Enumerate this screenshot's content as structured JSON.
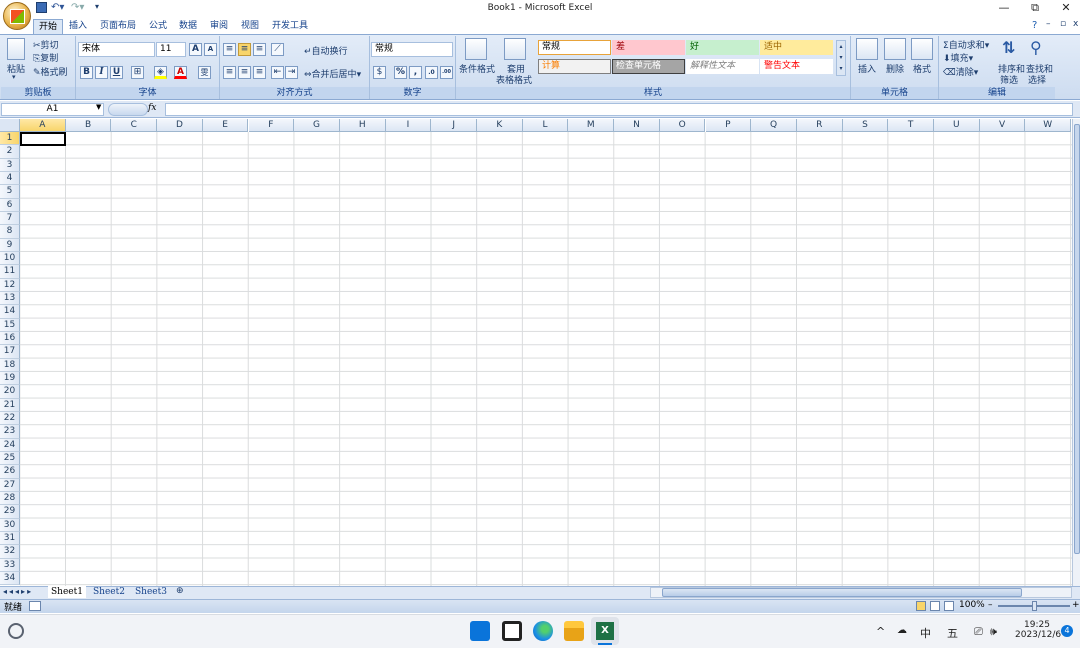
{
  "window": {
    "title": "Book1 - Microsoft Excel",
    "controls": {
      "minimize": "—",
      "restore": "⧉",
      "close": "✕"
    },
    "doc_controls": {
      "help": "?",
      "minimize": "–",
      "restore": "▫",
      "close": "x"
    }
  },
  "qat": {
    "save": "save",
    "undo": "undo",
    "redo": "redo",
    "customize": "▾"
  },
  "tabs": [
    "开始",
    "插入",
    "页面布局",
    "公式",
    "数据",
    "审阅",
    "视图",
    "开发工具"
  ],
  "ribbon": {
    "clipboard": {
      "paste": "粘贴",
      "cut": "剪切",
      "copy": "复制",
      "format_painter": "格式刷",
      "label": "剪贴板"
    },
    "font": {
      "name": "宋体",
      "size": "11",
      "bold": "B",
      "italic": "I",
      "underline": "U",
      "label": "字体",
      "grow": "A",
      "shrink": "A",
      "fontcolor": "A",
      "phonetic": "雯"
    },
    "alignment": {
      "wrap": "自动换行",
      "merge": "合并后居中",
      "label": "对齐方式"
    },
    "number": {
      "format": "常规",
      "percent": "%",
      "comma": ",",
      "inc_decimal": ".0",
      "dec_decimal": ".00",
      "label": "数字"
    },
    "styles": {
      "conditional": "条件格式",
      "table_1": "套用",
      "table_2": "表格格式",
      "cells": [
        {
          "text": "常规",
          "bg": "#ffffff",
          "color": "#000000",
          "border": "#e8a33a"
        },
        {
          "text": "差",
          "bg": "#ffc7ce",
          "color": "#9c0006",
          "border": "#ffc7ce"
        },
        {
          "text": "好",
          "bg": "#c6efce",
          "color": "#006100",
          "border": "#c6efce"
        },
        {
          "text": "适中",
          "bg": "#ffeb9c",
          "color": "#9c6500",
          "border": "#ffeb9c"
        },
        {
          "text": "计算",
          "bg": "#f2f2f2",
          "color": "#fa7d00",
          "border": "#7f7f7f"
        },
        {
          "text": "检查单元格",
          "bg": "#a5a5a5",
          "color": "#ffffff",
          "border": "#3f3f3f"
        },
        {
          "text": "解释性文本",
          "bg": "#ffffff",
          "color": "#7f7f7f",
          "border": "#ffffff"
        },
        {
          "text": "警告文本",
          "bg": "#ffffff",
          "color": "#ff0000",
          "border": "#ffffff"
        }
      ],
      "label": "样式"
    },
    "cells_group": {
      "insert": "插入",
      "delete": "删除",
      "format": "格式",
      "label": "单元格"
    },
    "editing": {
      "autosum": "自动求和",
      "fill": "填充",
      "clear": "清除",
      "sort_1": "排序和",
      "sort_2": "筛选",
      "find_1": "查找和",
      "find_2": "选择",
      "label": "编辑"
    }
  },
  "formula_bar": {
    "name_box": "A1",
    "fx": "fx",
    "value": ""
  },
  "columns": [
    "A",
    "B",
    "C",
    "D",
    "E",
    "F",
    "G",
    "H",
    "I",
    "J",
    "K",
    "L",
    "M",
    "N",
    "O",
    "P",
    "Q",
    "R",
    "S",
    "T",
    "U",
    "V",
    "W"
  ],
  "rows": [
    "1",
    "2",
    "3",
    "4",
    "5",
    "6",
    "7",
    "8",
    "9",
    "10",
    "11",
    "12",
    "13",
    "14",
    "15",
    "16",
    "17",
    "18",
    "19",
    "20",
    "21",
    "22",
    "23",
    "24",
    "25",
    "26",
    "27",
    "28",
    "29",
    "30",
    "31",
    "32",
    "33",
    "34"
  ],
  "sheets": [
    "Sheet1",
    "Sheet2",
    "Sheet3"
  ],
  "status": {
    "ready": "就绪",
    "zoom": "100%",
    "zoom_minus": "–",
    "zoom_plus": "+"
  },
  "taskbar": {
    "ime_1": "中",
    "ime_2": "五",
    "time": "19:25",
    "date": "2023/12/6",
    "notifications": "4",
    "chevron": "^"
  }
}
